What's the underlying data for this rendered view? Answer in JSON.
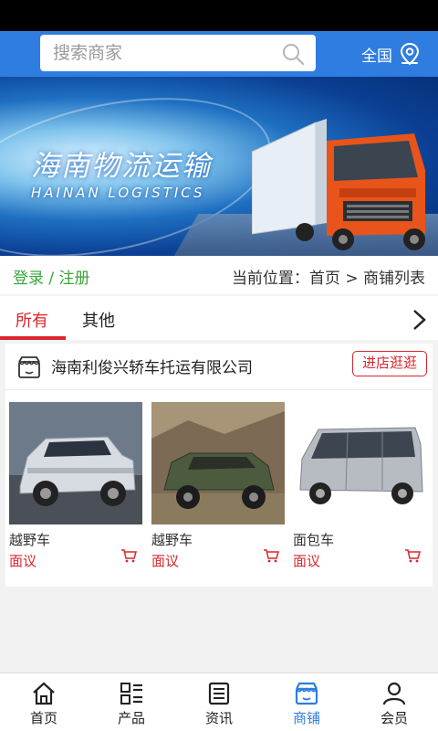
{
  "header": {
    "search_placeholder": "搜索商家",
    "region_label": "全国"
  },
  "banner": {
    "title": "海南物流运输",
    "subtitle": "HAINAN LOGISTICS"
  },
  "info_row": {
    "login_link": "登录 / 注册",
    "breadcrumb": "当前位置：首页 > 商铺列表"
  },
  "tabs": [
    {
      "label": "所有",
      "active": true
    },
    {
      "label": "其他",
      "active": false
    }
  ],
  "store": {
    "name": "海南利俊兴轿车托运有限公司",
    "visit_label": "进店逛逛",
    "products": [
      {
        "name": "越野车",
        "price": "面议"
      },
      {
        "name": "越野车",
        "price": "面议"
      },
      {
        "name": "面包车",
        "price": "面议"
      }
    ]
  },
  "bottom_nav": [
    {
      "label": "首页",
      "icon": "home-icon",
      "active": false
    },
    {
      "label": "产品",
      "icon": "grid-list-icon",
      "active": false
    },
    {
      "label": "资讯",
      "icon": "news-icon",
      "active": false
    },
    {
      "label": "商铺",
      "icon": "store-icon",
      "active": true
    },
    {
      "label": "会员",
      "icon": "person-icon",
      "active": false
    }
  ],
  "colors": {
    "header_blue": "#2f7de0",
    "accent_red": "#d9262d",
    "login_green": "#3aa53a"
  }
}
